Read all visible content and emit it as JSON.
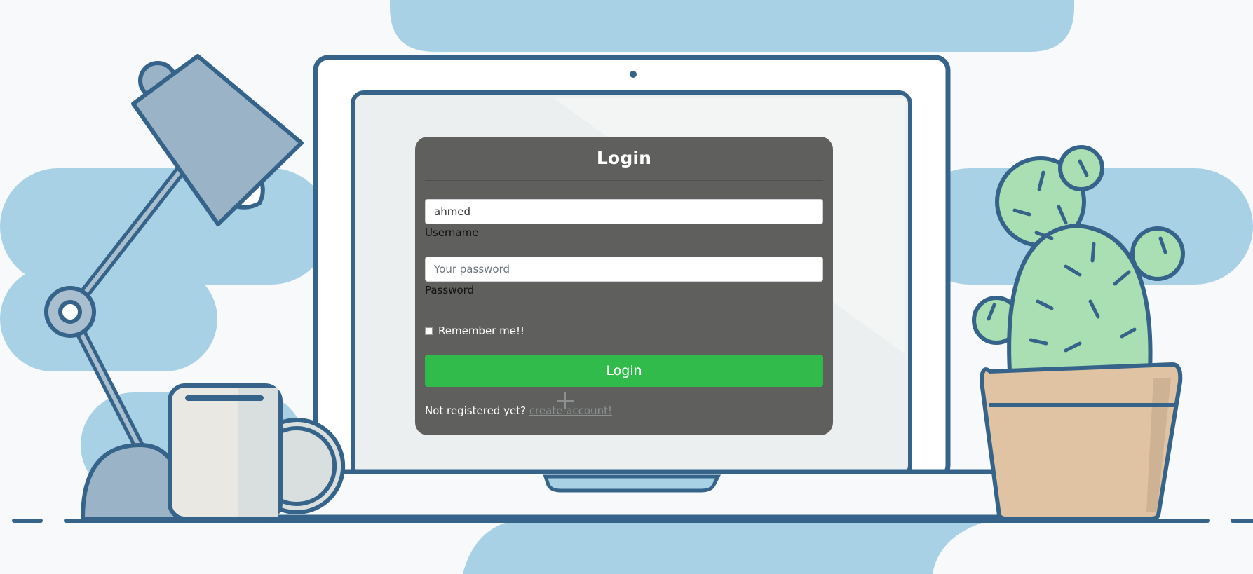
{
  "login": {
    "title": "Login",
    "username": {
      "value": "ahmed",
      "label": "Username"
    },
    "password": {
      "placeholder": "Your password",
      "label": "Password"
    },
    "remember": {
      "label": "Remember me!!",
      "checked": false
    },
    "submit_label": "Login",
    "register": {
      "prompt": "Not registered yet?",
      "link": "create account!"
    }
  },
  "colors": {
    "card": "#5f605e",
    "button": "#30bb4a",
    "sky_blob": "#a8d1e6",
    "outline": "#366389",
    "cactus": "#a9dfb2",
    "pot": "#e0c3a3"
  },
  "illustration": {
    "icons": [
      "desk-lamp-icon",
      "laptop-icon",
      "coffee-mug-icon",
      "cactus-icon",
      "flower-pot-icon"
    ]
  }
}
